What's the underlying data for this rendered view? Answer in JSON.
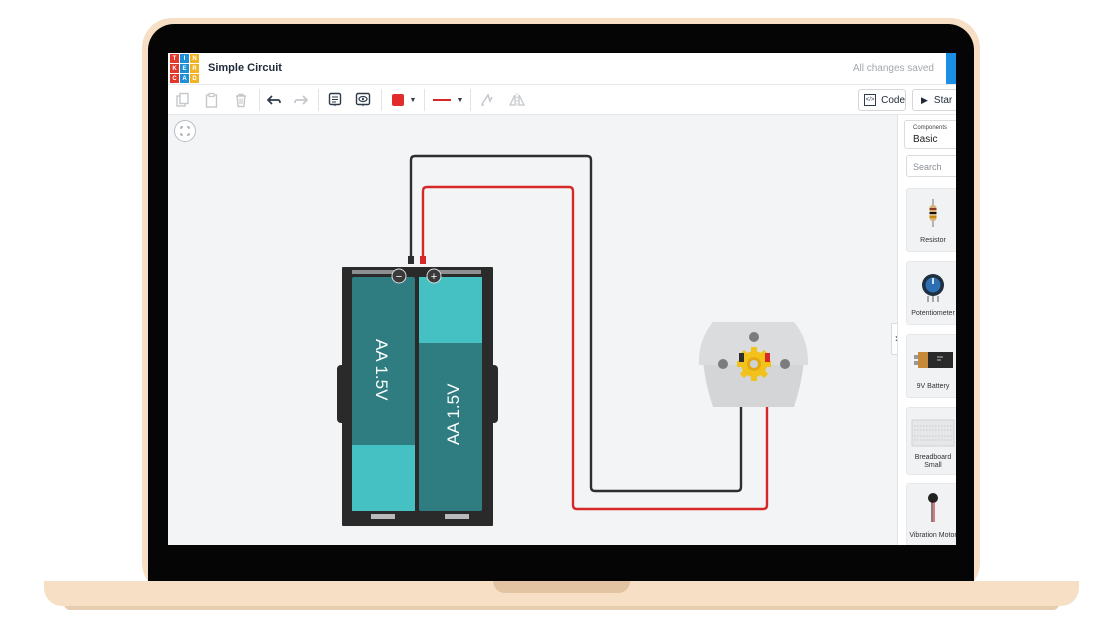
{
  "app": {
    "logo_letters": [
      "T",
      "I",
      "N",
      "K",
      "E",
      "R",
      "C",
      "A",
      "D"
    ],
    "logo_colors": [
      "#e2382c",
      "#1c8fd6",
      "#f0b323",
      "#e2382c",
      "#1c8fd6",
      "#f0b323",
      "#e2382c",
      "#1c8fd6",
      "#f0b323"
    ],
    "title": "Simple Circuit",
    "save_status": "All changes saved",
    "accent": "#1a8fe3"
  },
  "toolbar": {
    "copy_icon": "copy-icon",
    "paste_icon": "paste-icon",
    "delete_icon": "trash-icon",
    "undo_icon": "undo-icon",
    "redo_icon": "redo-icon",
    "notes_icon": "notes-icon",
    "notes_visibility_icon": "eye-note-icon",
    "wire_color": "#e22b2b",
    "wire_type_icon": "wire-type-icon",
    "rotate_icon": "rotate-icon",
    "flip_icon": "flip-icon",
    "code_label": "Code",
    "start_label": "Star"
  },
  "sidebar": {
    "components_label": "Components",
    "components_value": "Basic",
    "search_placeholder": "Search",
    "items": [
      {
        "label": "Resistor"
      },
      {
        "label": "Potentiometer"
      },
      {
        "label": "9V Battery"
      },
      {
        "label": "Breadboard Small"
      },
      {
        "label": "Vibration Motor"
      }
    ]
  },
  "canvas": {
    "battery_cells": [
      "AA 1.5V",
      "AA 1.5V"
    ],
    "battery_polarity": [
      "−",
      "+"
    ],
    "wire_colors": {
      "negative": "#2e2e2e",
      "positive": "#d62828"
    }
  }
}
